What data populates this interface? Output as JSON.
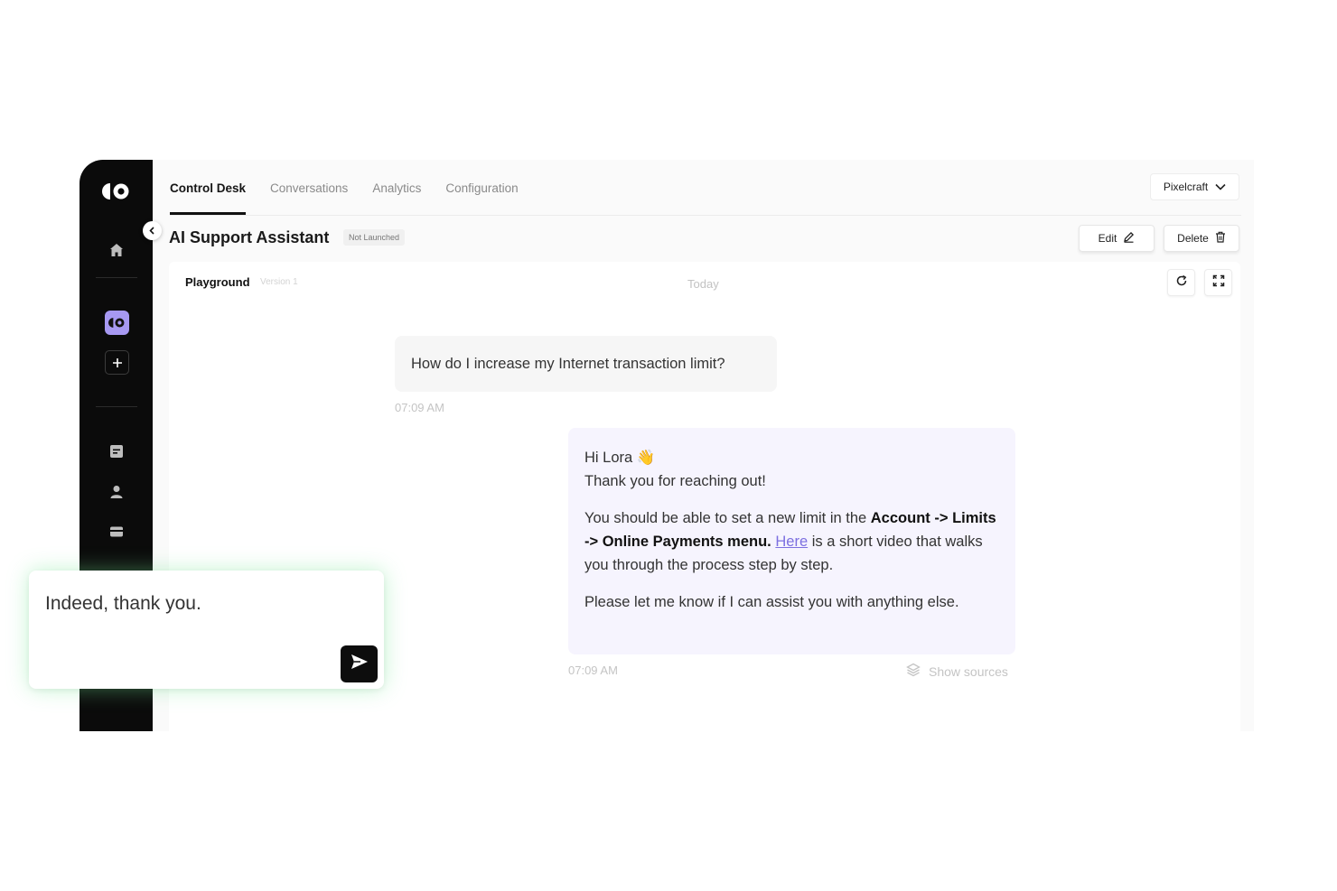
{
  "nav": {
    "tabs": [
      {
        "label": "Control Desk",
        "active": true
      },
      {
        "label": "Conversations",
        "active": false
      },
      {
        "label": "Analytics",
        "active": false
      },
      {
        "label": "Configuration",
        "active": false
      }
    ],
    "workspace": "Pixelcraft"
  },
  "sidebar": {
    "icons": [
      "logo-icon",
      "home-icon",
      "assistant-icon",
      "plus-icon",
      "document-icon",
      "user-icon",
      "card-icon"
    ],
    "active_color": "#a799f2"
  },
  "assistant": {
    "title": "AI Support Assistant",
    "status": "Not Launched",
    "edit_label": "Edit",
    "delete_label": "Delete"
  },
  "playground": {
    "title": "Playground",
    "version": "Version 1",
    "date_label": "Today",
    "user_message": "How do I increase my Internet transaction limit?",
    "user_time": "07:09 AM",
    "bot": {
      "greeting": "Hi Lora",
      "greeting_emoji": "👋",
      "thanks": "Thank you for reaching out!",
      "p2_before": "You should be able to set a new limit in the ",
      "p2_bold": "Account -> Limits -> Online Payments menu.",
      "p2_link": "Here",
      "p2_after": " is a short video that walks you through the process step by step.",
      "p3": "Please let me know if I can assist you with anything else."
    },
    "bot_time": "07:09 AM",
    "sources_label": "Show sources"
  },
  "composer": {
    "text": "Indeed, thank you."
  }
}
